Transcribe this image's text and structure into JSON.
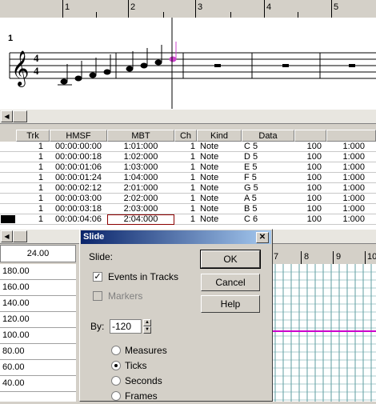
{
  "ruler": {
    "marks": [
      "1",
      "2",
      "3",
      "4",
      "5"
    ]
  },
  "staff": {
    "measure_number": "1",
    "time_signature": {
      "top": "4",
      "bottom": "4"
    }
  },
  "event_list": {
    "columns": [
      "Trk",
      "HMSF",
      "MBT",
      "Ch",
      "Kind",
      "Data"
    ],
    "rows": [
      {
        "trk": "1",
        "hmsf": "00:00:00:00",
        "mbt": "1:01:000",
        "ch": "1",
        "kind": "Note",
        "data": "C 5",
        "vel": "100",
        "dur": "1:000"
      },
      {
        "trk": "1",
        "hmsf": "00:00:00:18",
        "mbt": "1:02:000",
        "ch": "1",
        "kind": "Note",
        "data": "D 5",
        "vel": "100",
        "dur": "1:000"
      },
      {
        "trk": "1",
        "hmsf": "00:00:01:06",
        "mbt": "1:03:000",
        "ch": "1",
        "kind": "Note",
        "data": "E 5",
        "vel": "100",
        "dur": "1:000"
      },
      {
        "trk": "1",
        "hmsf": "00:00:01:24",
        "mbt": "1:04:000",
        "ch": "1",
        "kind": "Note",
        "data": "F 5",
        "vel": "100",
        "dur": "1:000"
      },
      {
        "trk": "1",
        "hmsf": "00:00:02:12",
        "mbt": "2:01:000",
        "ch": "1",
        "kind": "Note",
        "data": "G 5",
        "vel": "100",
        "dur": "1:000"
      },
      {
        "trk": "1",
        "hmsf": "00:00:03:00",
        "mbt": "2:02:000",
        "ch": "1",
        "kind": "Note",
        "data": "A 5",
        "vel": "100",
        "dur": "1:000"
      },
      {
        "trk": "1",
        "hmsf": "00:00:03:18",
        "mbt": "2:03:000",
        "ch": "1",
        "kind": "Note",
        "data": "B 5",
        "vel": "100",
        "dur": "1:000"
      },
      {
        "trk": "1",
        "hmsf": "00:00:04:06",
        "mbt": "2:04:000",
        "ch": "1",
        "kind": "Note",
        "data": "C 6",
        "vel": "100",
        "dur": "1:000"
      }
    ]
  },
  "tempo": {
    "current": "24.00",
    "axis": [
      "180.00",
      "160.00",
      "140.00",
      "120.00",
      "100.00",
      "80.00",
      "60.00",
      "40.00"
    ]
  },
  "grid_ruler": {
    "marks": [
      "7",
      "8",
      "9",
      "10"
    ]
  },
  "dialog": {
    "title": "Slide",
    "close_glyph": "✕",
    "slide_label": "Slide:",
    "events_in_tracks": {
      "label": "Events in Tracks",
      "checked": true
    },
    "markers": {
      "label": "Markers",
      "checked": false,
      "disabled": true
    },
    "by_label": "By:",
    "by_value": "-120",
    "units": [
      {
        "label": "Measures",
        "selected": false
      },
      {
        "label": "Ticks",
        "selected": true
      },
      {
        "label": "Seconds",
        "selected": false
      },
      {
        "label": "Frames",
        "selected": false
      }
    ],
    "ok": "OK",
    "cancel": "Cancel",
    "help": "Help"
  },
  "colors": {
    "title_bar": "#0a246a",
    "selected_note": "#cc44cc",
    "tempo_line": "#cc00cc",
    "grid": "#5f9ea0"
  }
}
